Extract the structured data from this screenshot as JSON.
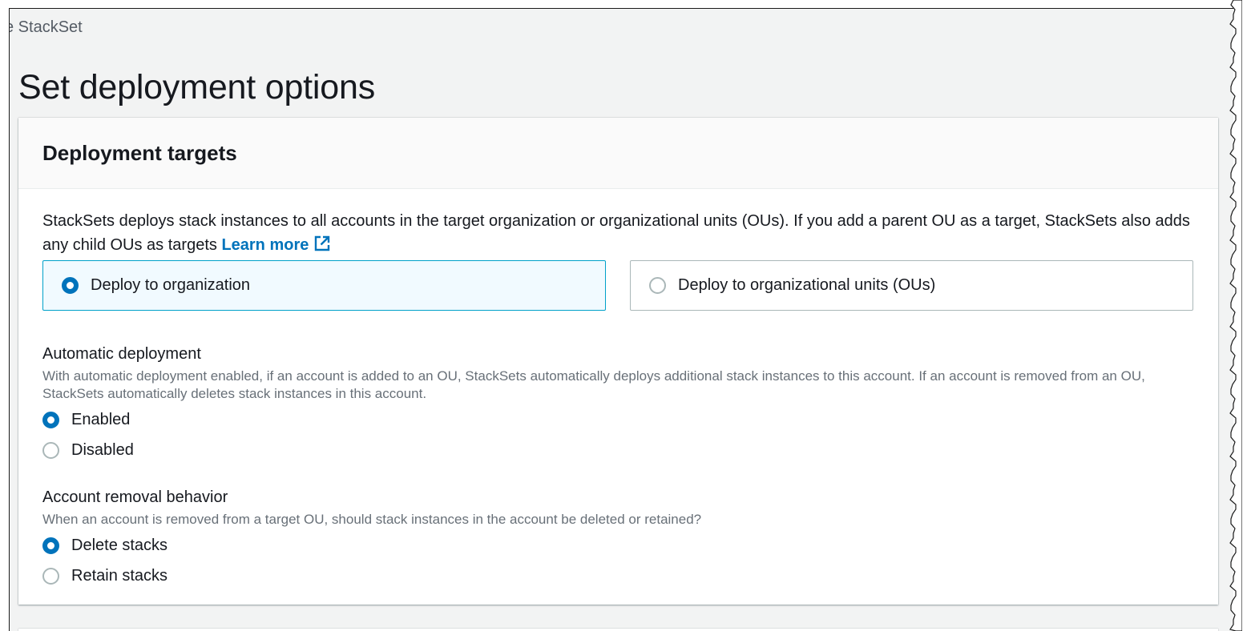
{
  "breadcrumb": {
    "text": "e StackSet"
  },
  "page": {
    "title": "Set deployment options"
  },
  "deployment_targets": {
    "title": "Deployment targets",
    "description": "StackSets deploys stack instances to all accounts in the target organization or organizational units (OUs). If you add a parent OU as a target, StackSets also adds any child OUs as targets",
    "learn_more": "Learn more",
    "options": [
      {
        "label": "Deploy to organization",
        "selected": true
      },
      {
        "label": "Deploy to organizational units (OUs)",
        "selected": false
      }
    ]
  },
  "automatic_deployment": {
    "label": "Automatic deployment",
    "description": "With automatic deployment enabled, if an account is added to an OU, StackSets automatically deploys additional stack instances to this account. If an account is removed from an OU, StackSets automatically deletes stack instances in this account.",
    "options": [
      {
        "label": "Enabled",
        "selected": true
      },
      {
        "label": "Disabled",
        "selected": false
      }
    ]
  },
  "account_removal": {
    "label": "Account removal behavior",
    "description": "When an account is removed from a target OU, should stack instances in the account be deleted or retained?",
    "options": [
      {
        "label": "Delete stacks",
        "selected": true
      },
      {
        "label": "Retain stacks",
        "selected": false
      }
    ]
  },
  "colors": {
    "accent": "#0073bb",
    "selected_tile_border": "#00a1c9",
    "selected_tile_bg": "#f1faff",
    "page_bg": "#f2f3f3"
  }
}
